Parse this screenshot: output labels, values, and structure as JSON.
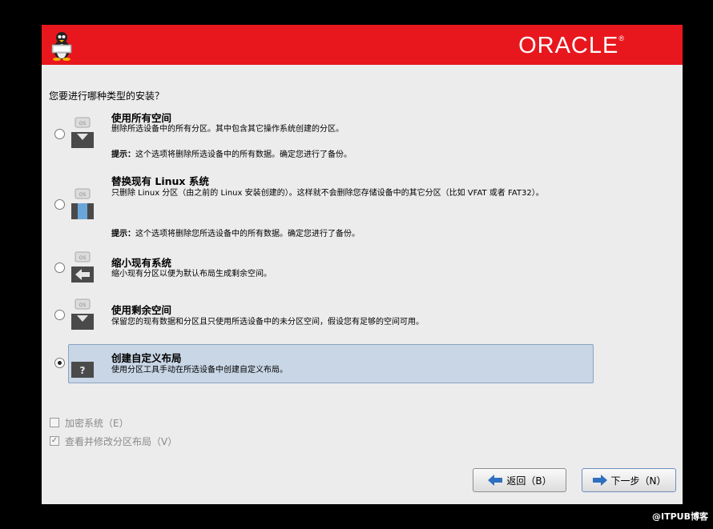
{
  "banner": {
    "logo_text": "ORACLE",
    "logo_mark": "®",
    "color": "#e8171d"
  },
  "question": "您要进行哪种类型的安装？",
  "options": [
    {
      "title": "使用所有空间",
      "desc": "删除所选设备中的所有分区。其中包含其它操作系统创建的分区。",
      "hint_label": "提示：",
      "hint": "这个选项将删除所选设备中的所有数据。确定您进行了备份。",
      "icon": "disk-erase-icon",
      "checked": false
    },
    {
      "title": "替换现有 Linux 系统",
      "desc": "只删除 Linux 分区（由之前的 Linux 安装创建的）。这样就不会删除您存储设备中的其它分区（比如 VFAT 或者 FAT32）。",
      "hint_label": "提示：",
      "hint": "这个选项将删除您所选设备中的所有数据。确定您进行了备份。",
      "icon": "disk-replace-icon",
      "checked": false
    },
    {
      "title": "缩小现有系统",
      "desc": "缩小现有分区以便为默认布局生成剩余空间。",
      "icon": "disk-shrink-icon",
      "checked": false
    },
    {
      "title": "使用剩余空间",
      "desc": "保留您的现有数据和分区且只使用所选设备中的未分区空间，假设您有足够的空间可用。",
      "icon": "disk-free-space-icon",
      "checked": false
    },
    {
      "title": "创建自定义布局",
      "desc": "使用分区工具手动在所选设备中创建自定义布局。",
      "icon": "disk-custom-icon",
      "icon_mark": "?",
      "checked": true
    }
  ],
  "checkboxes": [
    {
      "label": "加密系统（E）",
      "checked": false,
      "enabled": false
    },
    {
      "label": "查看并修改分区布局（V）",
      "checked": true,
      "enabled": false
    }
  ],
  "buttons": {
    "back": "返回（B）",
    "next": "下一步（N）"
  },
  "watermark": "@ITPUB博客"
}
